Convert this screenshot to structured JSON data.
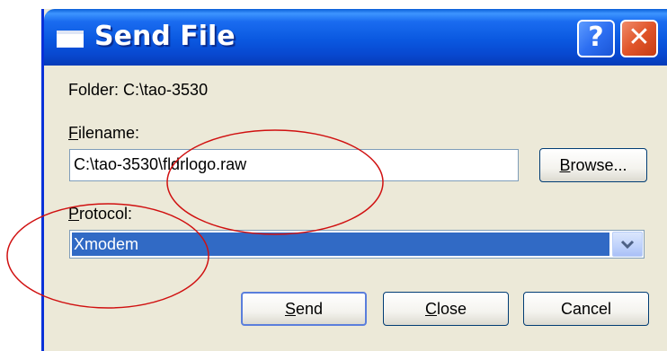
{
  "window": {
    "title": "Send File"
  },
  "titlebar": {
    "help_label": "?",
    "close_label": "✕"
  },
  "folder": {
    "text": "Folder:  C:\\tao-3530"
  },
  "filename": {
    "label_mnemonic": "F",
    "label_rest": "ilename:",
    "value": "C:\\tao-3530\\fldrlogo.raw"
  },
  "browse_button": {
    "mnemonic": "B",
    "rest": "rowse..."
  },
  "protocol": {
    "label_mnemonic": "P",
    "label_rest": "rotocol:",
    "selected": "Xmodem"
  },
  "buttons": {
    "send_mnemonic": "S",
    "send_rest": "end",
    "close_mnemonic": "C",
    "close_rest": "lose",
    "cancel": "Cancel"
  },
  "colors": {
    "accent_titlebar": "#0a58e0",
    "selection": "#316ac5",
    "annotation_red": "#d01010"
  }
}
